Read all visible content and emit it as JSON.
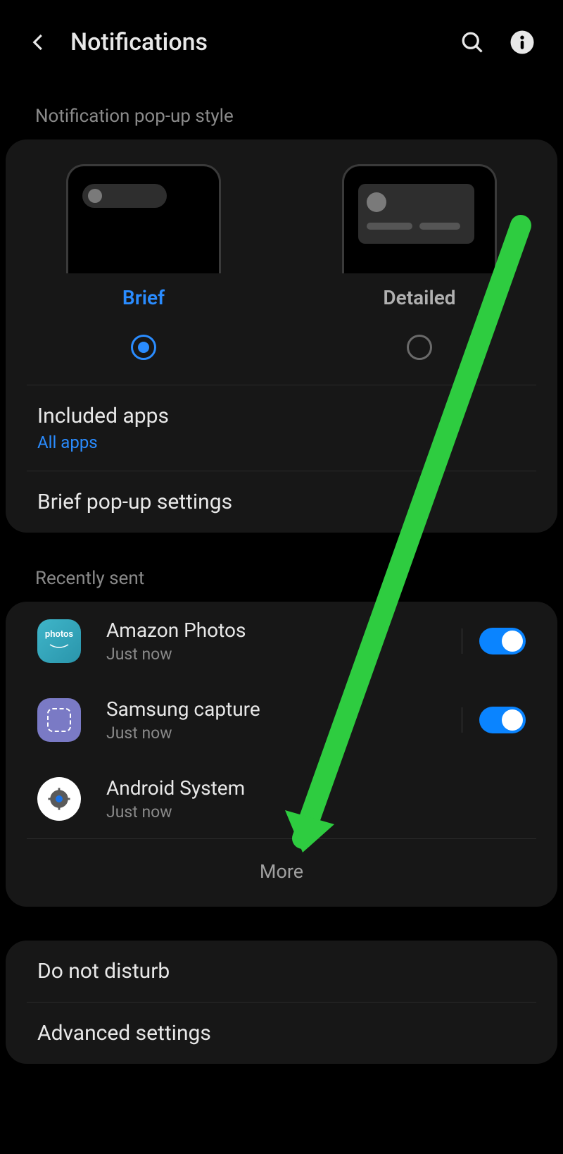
{
  "header": {
    "title": "Notifications"
  },
  "popup_style": {
    "section_label": "Notification pop-up style",
    "options": [
      {
        "label": "Brief",
        "selected": true
      },
      {
        "label": "Detailed",
        "selected": false
      }
    ],
    "included_apps": {
      "title": "Included apps",
      "value": "All apps"
    },
    "brief_settings": "Brief pop-up settings"
  },
  "recently_sent": {
    "section_label": "Recently sent",
    "items": [
      {
        "name": "Amazon Photos",
        "time": "Just now",
        "toggle": true,
        "icon": "photos"
      },
      {
        "name": "Samsung capture",
        "time": "Just now",
        "toggle": true,
        "icon": "capture"
      },
      {
        "name": "Android System",
        "time": "Just now",
        "toggle": null,
        "icon": "system"
      }
    ],
    "more": "More"
  },
  "other": {
    "dnd": "Do not disturb",
    "advanced": "Advanced settings"
  },
  "annotation": {
    "type": "arrow",
    "color": "#2ecc40"
  }
}
